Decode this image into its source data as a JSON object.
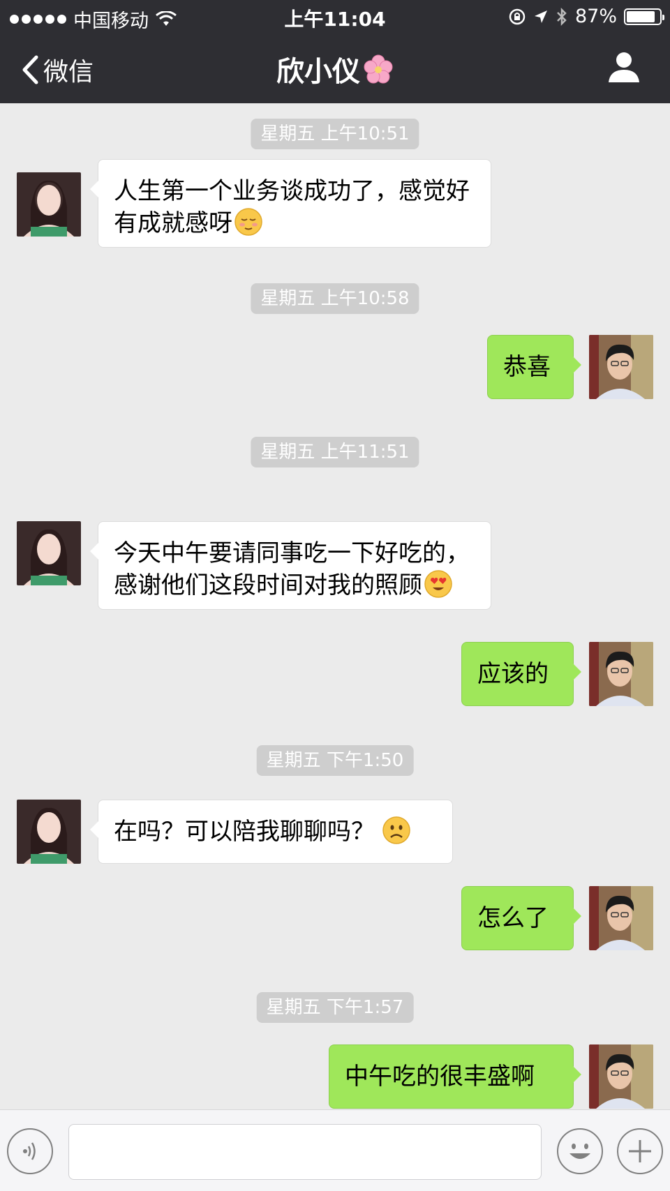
{
  "status_bar": {
    "carrier": "中国移动",
    "time": "上午11:04",
    "battery": "87%",
    "battery_level": 0.87
  },
  "nav": {
    "back_label": "微信",
    "title": "欣小仪",
    "title_icon": "cherry-blossom-icon",
    "profile_icon": "person-icon"
  },
  "messages": [
    {
      "type": "timestamp",
      "text": "星期五 上午10:51"
    },
    {
      "type": "incoming",
      "line1": "人生第一个业务谈成功了，感觉好",
      "line2": "有成就感呀",
      "emoji": "relieved-face"
    },
    {
      "type": "timestamp",
      "text": "星期五 上午10:58"
    },
    {
      "type": "outgoing",
      "text": "恭喜"
    },
    {
      "type": "timestamp",
      "text": "星期五 上午11:51"
    },
    {
      "type": "incoming",
      "line1": "今天中午要请同事吃一下好吃的，",
      "line2": "感谢他们这段时间对我的照顾",
      "emoji": "heart-eyes-face"
    },
    {
      "type": "outgoing",
      "text": "应该的"
    },
    {
      "type": "timestamp",
      "text": "星期五 下午1:50"
    },
    {
      "type": "incoming",
      "line1": "在吗？可以陪我聊聊吗？",
      "emoji": "frowning-face"
    },
    {
      "type": "outgoing",
      "text": "怎么了"
    },
    {
      "type": "timestamp",
      "text": "星期五 下午1:57"
    },
    {
      "type": "outgoing",
      "text": "中午吃的很丰盛啊"
    }
  ],
  "input_bar": {
    "voice_icon": "voice-icon",
    "emoji_icon": "emoji-icon",
    "plus_icon": "plus-icon",
    "value": ""
  },
  "colors": {
    "header_bg": "#2e2e33",
    "chat_bg": "#ebebeb",
    "outgoing_bubble": "#9fe75a",
    "incoming_bubble": "#ffffff"
  }
}
